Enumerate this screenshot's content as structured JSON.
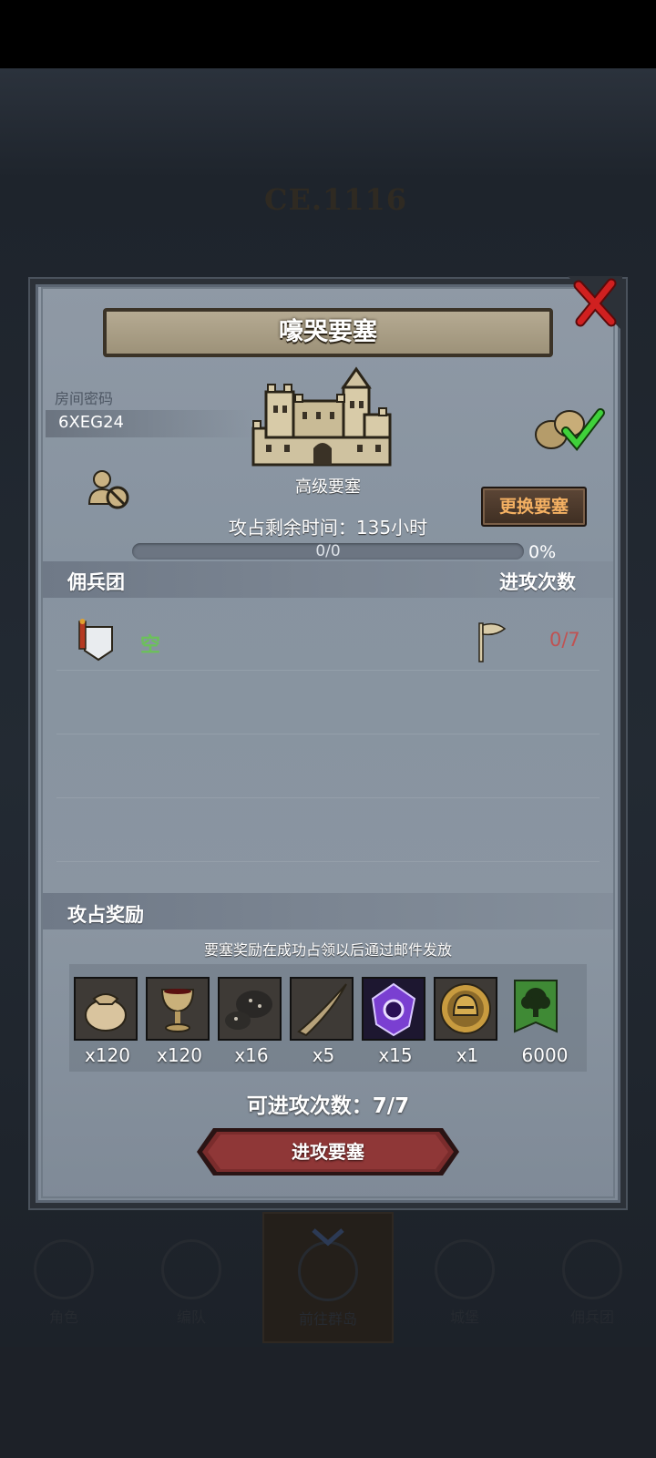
{
  "background": {
    "era_label": "CE.1116",
    "nav": [
      "角色",
      "编队",
      "前往群岛",
      "城堡",
      "佣兵团"
    ]
  },
  "dialog": {
    "title": "嚎哭要塞",
    "room_label": "房间密码",
    "room_code": "6XEG24",
    "fortress_level": "高级要塞",
    "change_button": "更换要塞",
    "remaining_time": "攻占剩余时间：135小时",
    "progress": {
      "text": "0/0",
      "percent_label": "0%",
      "fraction": 0
    },
    "mercenary_section": "佣兵团",
    "attack_count_header": "进攻次数",
    "mercenary_row": {
      "status": "空",
      "attacks": "0/7"
    },
    "rewards_section": "攻占奖励",
    "reward_note": "要塞奖励在成功占领以后通过邮件发放",
    "rewards": [
      {
        "icon": "sack-icon",
        "qty": "x120"
      },
      {
        "icon": "goblet-icon",
        "qty": "x120"
      },
      {
        "icon": "ore-icon",
        "qty": "x16"
      },
      {
        "icon": "horn-icon",
        "qty": "x5"
      },
      {
        "icon": "purple-crystal-icon",
        "qty": "x15"
      },
      {
        "icon": "helmet-medal-icon",
        "qty": "x1"
      },
      {
        "icon": "tree-banner-icon",
        "qty": "6000"
      }
    ],
    "attacks_available": "可进攻次数：7/7",
    "attack_button": "进攻要塞"
  },
  "colors": {
    "accent_orange": "#f4b062",
    "empty_green": "#6cc15a",
    "count_red": "#c05252",
    "close_red": "#d02020"
  }
}
